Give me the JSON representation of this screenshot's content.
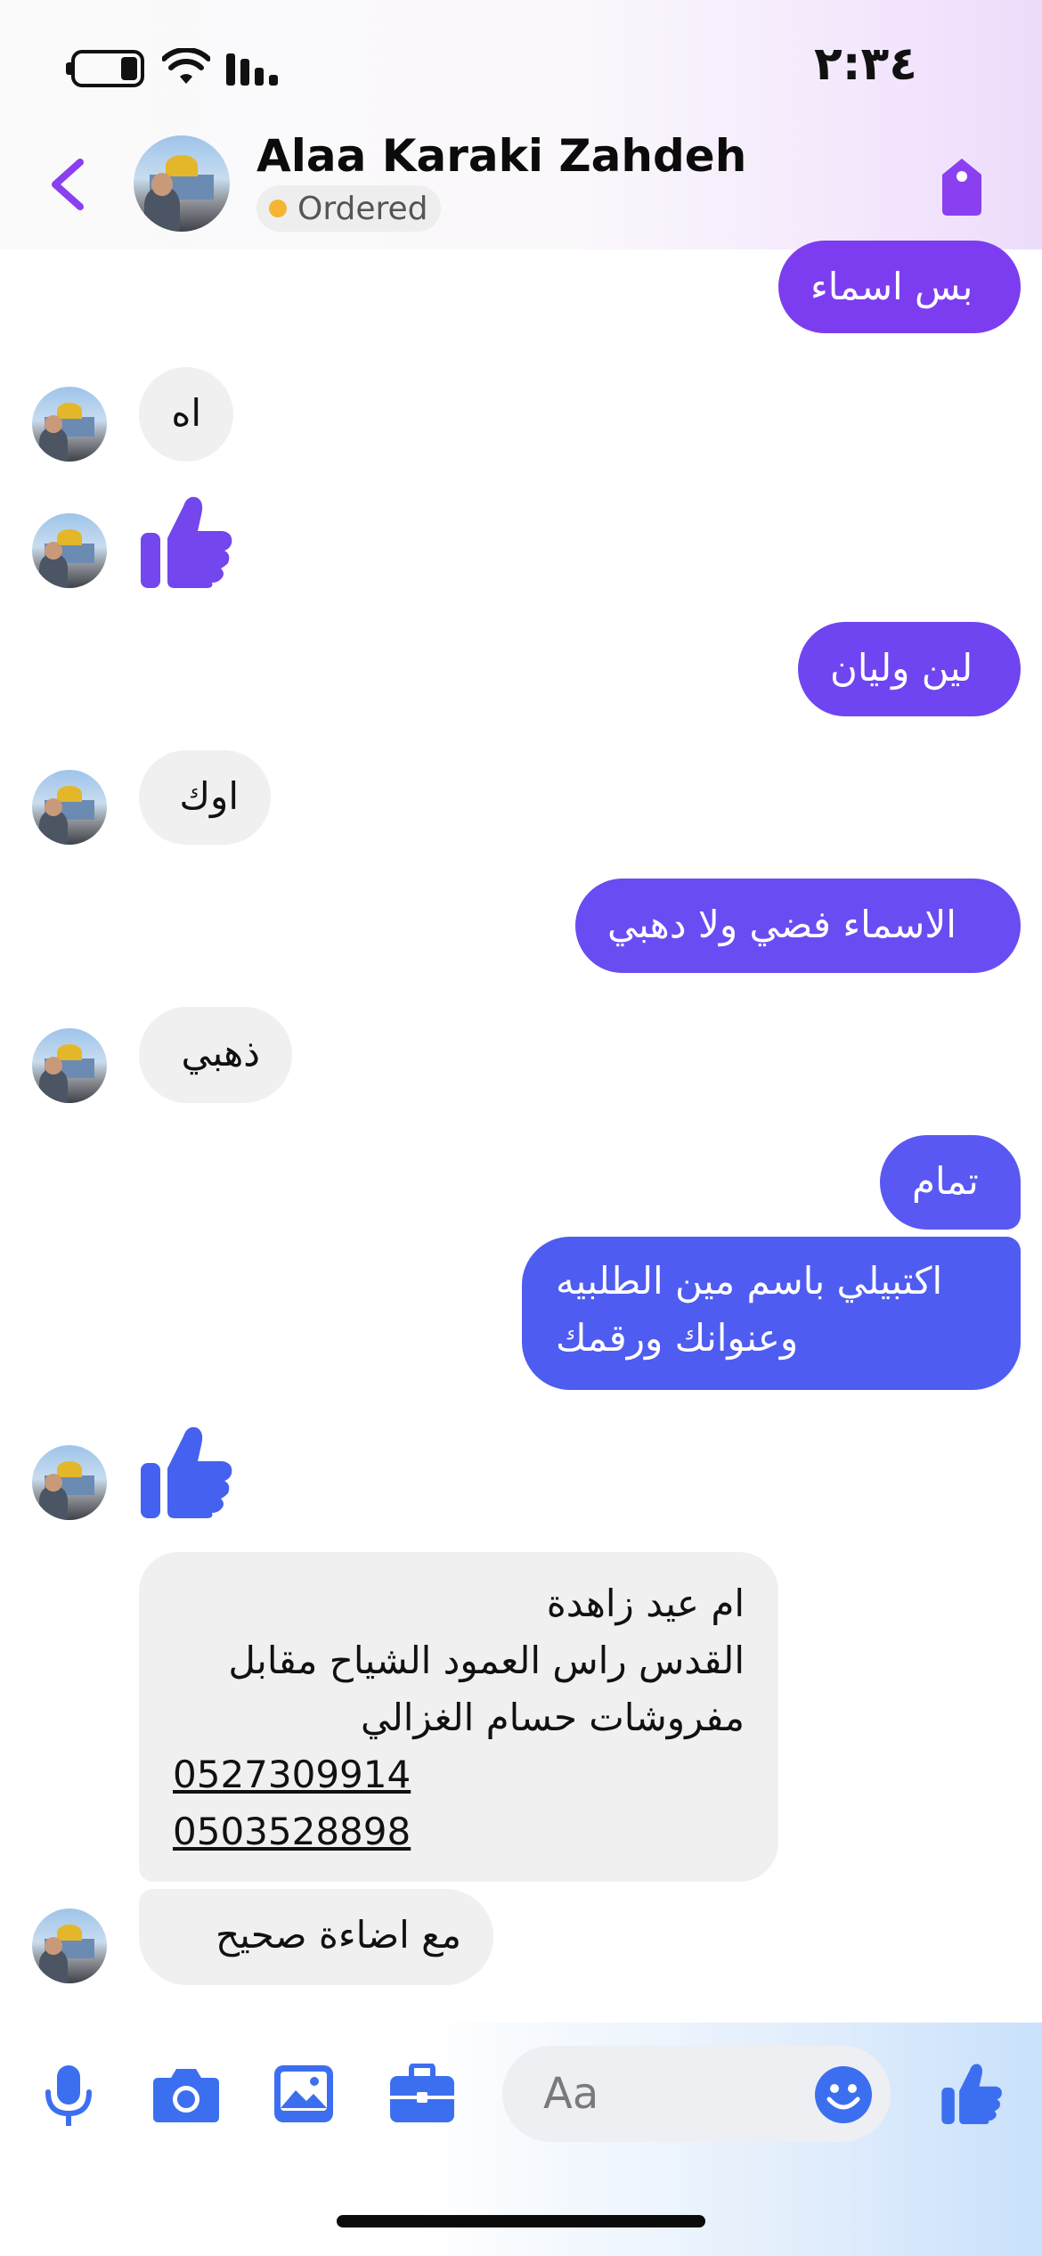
{
  "status_bar": {
    "time": "٢:٣٤"
  },
  "header": {
    "contact_name": "Alaa Karaki Zahdeh",
    "order_status": "Ordered",
    "icons": [
      "back-chevron-icon",
      "tag-icon"
    ]
  },
  "messages": [
    {
      "direction": "outgoing",
      "text": "بس اسماء"
    },
    {
      "direction": "incoming",
      "text": "اه"
    },
    {
      "direction": "incoming",
      "type": "like",
      "icon": "thumbs-up-icon"
    },
    {
      "direction": "outgoing",
      "text": "لين وليان"
    },
    {
      "direction": "incoming",
      "text": "اوك"
    },
    {
      "direction": "outgoing",
      "text": "الاسماء فضي ولا دهبي"
    },
    {
      "direction": "incoming",
      "text": "ذهبي"
    },
    {
      "direction": "outgoing",
      "text": "تمام"
    },
    {
      "direction": "outgoing",
      "lines": [
        "اكتبيلي باسم مين الطلبيه",
        "وعنوانك ورقمك"
      ]
    },
    {
      "direction": "incoming",
      "type": "like",
      "icon": "thumbs-up-icon"
    },
    {
      "direction": "incoming",
      "lines": [
        "ام عيد زاهدة",
        "القدس راس العمود الشياح مقابل",
        "مفروشات حسام الغزالي"
      ],
      "phones": [
        "0527309914",
        "0503528898"
      ]
    },
    {
      "direction": "incoming",
      "text": "مع اضاءة صحيح"
    }
  ],
  "composer": {
    "placeholder": "Aa",
    "icons": [
      "microphone-icon",
      "camera-icon",
      "gallery-icon",
      "briefcase-icon",
      "emoji-icon",
      "thumbs-up-icon"
    ]
  },
  "colors": {
    "outgoing_purple": "#7c3df0",
    "outgoing_indigo": "#6a4cf3",
    "outgoing_blue": "#4f5cf1",
    "incoming_bubble": "#f0f0f0",
    "accent_purple": "#8a3ff0",
    "accent_blue": "#3c6ff0",
    "ordered_dot": "#f5b533"
  }
}
